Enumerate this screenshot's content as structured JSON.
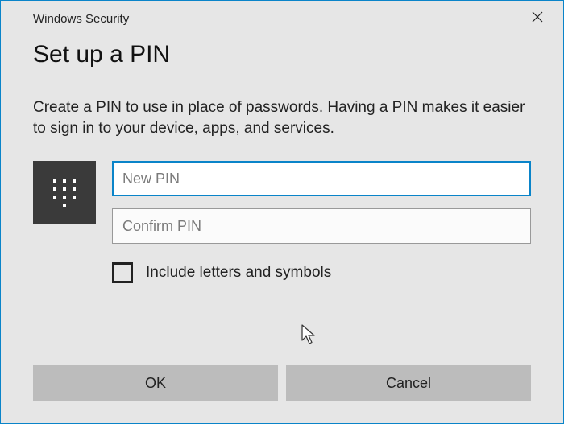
{
  "window": {
    "title": "Windows Security"
  },
  "dialog": {
    "heading": "Set up a PIN",
    "description": "Create a PIN to use in place of passwords. Having a PIN makes it easier to sign in to your device, apps, and services."
  },
  "fields": {
    "newPin": {
      "placeholder": "New PIN",
      "value": ""
    },
    "confirmPin": {
      "placeholder": "Confirm PIN",
      "value": ""
    }
  },
  "checkbox": {
    "label": "Include letters and symbols",
    "checked": false
  },
  "buttons": {
    "ok": "OK",
    "cancel": "Cancel"
  }
}
